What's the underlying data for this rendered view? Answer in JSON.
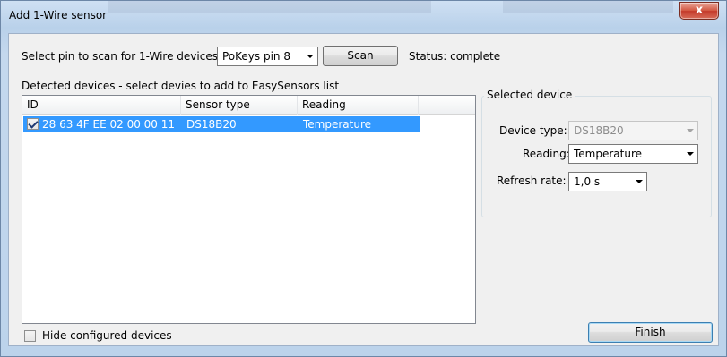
{
  "window": {
    "title": "Add 1-Wire sensor",
    "close_glyph": "x"
  },
  "scan": {
    "label": "Select pin to scan for 1-Wire devices:",
    "pin_selected": "PoKeys pin 8",
    "scan_button": "Scan",
    "status": "Status: complete"
  },
  "devices": {
    "caption": "Detected devices - select devies to add to EasySensors list",
    "columns": [
      "ID",
      "Sensor type",
      "Reading"
    ],
    "rows": [
      {
        "checked": true,
        "id": "28 63 4F EE 02 00 00 11",
        "sensor_type": "DS18B20",
        "reading": "Temperature",
        "selected": true
      }
    ]
  },
  "selected_device": {
    "group_title": "Selected device",
    "device_type_label": "Device type:",
    "device_type_value": "DS18B20",
    "reading_label": "Reading:",
    "reading_value": "Temperature",
    "refresh_label": "Refresh rate:",
    "refresh_value": "1,0 s"
  },
  "footer": {
    "hide_configured_label": "Hide configured devices",
    "hide_configured_checked": false,
    "finish_button": "Finish"
  },
  "colors": {
    "selection": "#3399ff",
    "close_button": "#c3392a"
  }
}
